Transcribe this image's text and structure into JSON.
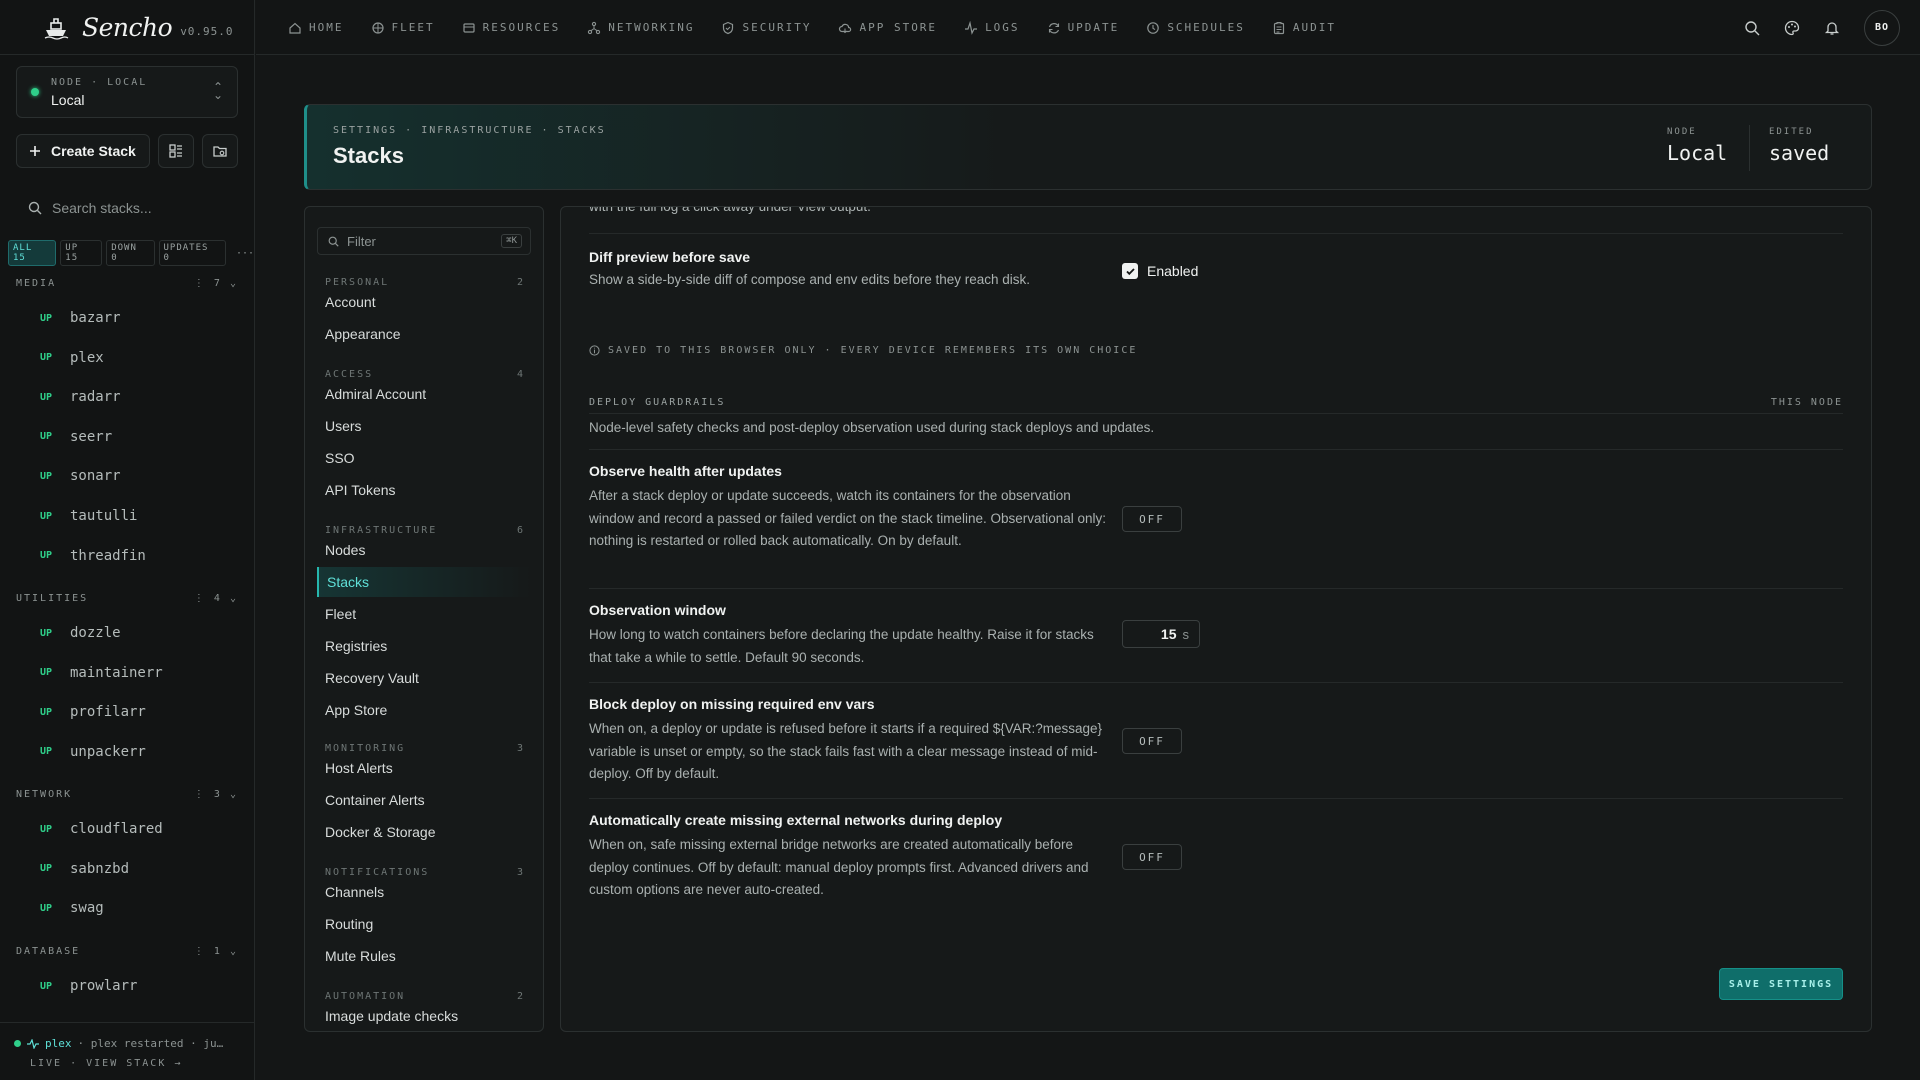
{
  "app": {
    "name": "Sencho",
    "version": "v0.95.0"
  },
  "node": {
    "caption": "NODE · LOCAL",
    "name": "Local"
  },
  "sidebar": {
    "create_label": "Create Stack",
    "search_placeholder": "Search stacks...",
    "filters": [
      {
        "label": "ALL 15",
        "active": true
      },
      {
        "label": "UP 15"
      },
      {
        "label": "DOWN 0"
      },
      {
        "label": "UPDATES 0"
      }
    ],
    "more": "···",
    "groups": [
      {
        "name": "MEDIA",
        "count": "⋮ 7 ⌄",
        "stacks": [
          "bazarr",
          "plex",
          "radarr",
          "seerr",
          "sonarr",
          "tautulli",
          "threadfin"
        ]
      },
      {
        "name": "UTILITIES",
        "count": "⋮ 4 ⌄",
        "stacks": [
          "dozzle",
          "maintainerr",
          "profilarr",
          "unpackerr"
        ]
      },
      {
        "name": "NETWORK",
        "count": "⋮ 3 ⌄",
        "stacks": [
          "cloudflared",
          "sabnzbd",
          "swag"
        ]
      },
      {
        "name": "DATABASE",
        "count": "⋮ 1 ⌄",
        "stacks": [
          "prowlarr"
        ]
      }
    ],
    "status_up": "UP",
    "footer": {
      "stack": "plex",
      "message": "· plex restarted · ju…",
      "line2": "LIVE · VIEW STACK →"
    }
  },
  "topnav": {
    "items": [
      {
        "label": "HOME",
        "icon": "home-icon"
      },
      {
        "label": "FLEET",
        "icon": "fleet-icon"
      },
      {
        "label": "RESOURCES",
        "icon": "resources-icon"
      },
      {
        "label": "NETWORKING",
        "icon": "networking-icon"
      },
      {
        "label": "SECURITY",
        "icon": "shield-icon"
      },
      {
        "label": "APP STORE",
        "icon": "cloud-icon"
      },
      {
        "label": "LOGS",
        "icon": "activity-icon"
      },
      {
        "label": "UPDATE",
        "icon": "refresh-icon"
      },
      {
        "label": "SCHEDULES",
        "icon": "clock-icon"
      },
      {
        "label": "AUDIT",
        "icon": "clipboard-icon"
      }
    ],
    "avatar": "BO"
  },
  "header": {
    "breadcrumb": "SETTINGS · INFRASTRUCTURE · STACKS",
    "title": "Stacks",
    "node_cap": "NODE",
    "node_val": "Local",
    "edited_cap": "EDITED",
    "edited_val": "saved"
  },
  "settings_nav": {
    "filter_placeholder": "Filter",
    "filter_kbd": "⌘K",
    "groups": [
      {
        "name": "PERSONAL",
        "count": "2",
        "items": [
          "Account",
          "Appearance"
        ]
      },
      {
        "name": "ACCESS",
        "count": "4",
        "items": [
          "Admiral Account",
          "Users",
          "SSO",
          "API Tokens"
        ]
      },
      {
        "name": "INFRASTRUCTURE",
        "count": "6",
        "items": [
          "Nodes",
          "Stacks",
          "Fleet",
          "Registries",
          "Recovery Vault",
          "App Store"
        ]
      },
      {
        "name": "MONITORING",
        "count": "3",
        "items": [
          "Host Alerts",
          "Container Alerts",
          "Docker & Storage"
        ]
      },
      {
        "name": "NOTIFICATIONS",
        "count": "3",
        "items": [
          "Channels",
          "Routing",
          "Mute Rules"
        ]
      },
      {
        "name": "AUTOMATION",
        "count": "2",
        "items": [
          "Image update checks"
        ]
      }
    ],
    "active": "Stacks"
  },
  "main": {
    "clipped_text": "with the full log a click away under View output.",
    "diff": {
      "title": "Diff preview before save",
      "desc": "Show a side-by-side diff of compose and env edits before they reach disk.",
      "checkbox_label": "Enabled"
    },
    "note": "SAVED TO THIS BROWSER ONLY · EVERY DEVICE REMEMBERS ITS OWN CHOICE",
    "guardrails": {
      "caption": "DEPLOY GUARDRAILS",
      "scope": "THIS NODE",
      "desc": "Node-level safety checks and post-deploy observation used during stack deploys and updates."
    },
    "observe": {
      "title": "Observe health after updates",
      "desc": "After a stack deploy or update succeeds, watch its containers for the observation window and record a passed or failed verdict on the stack timeline. Observational only: nothing is restarted or rolled back automatically. On by default.",
      "toggle": "OFF"
    },
    "window": {
      "title": "Observation window",
      "desc": "How long to watch containers before declaring the update healthy. Raise it for stacks that take a while to settle. Default 90 seconds.",
      "value": "15",
      "unit": "s"
    },
    "block": {
      "title": "Block deploy on missing required env vars",
      "desc": "When on, a deploy or update is refused before it starts if a required ${VAR:?message} variable is unset or empty, so the stack fails fast with a clear message instead of mid-deploy. Off by default.",
      "toggle": "OFF"
    },
    "networks": {
      "title": "Automatically create missing external networks during deploy",
      "desc": "When on, safe missing external bridge networks are created automatically before deploy continues. Off by default: manual deploy prompts first. Advanced drivers and custom options are never auto-created.",
      "toggle": "OFF"
    },
    "save_label": "SAVE SETTINGS"
  }
}
